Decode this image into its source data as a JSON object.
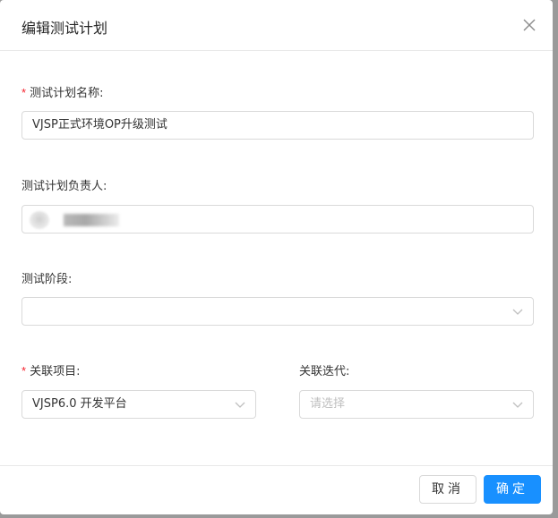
{
  "modal": {
    "title": "编辑测试计划",
    "close_icon": "close-icon"
  },
  "form": {
    "plan_name": {
      "required_mark": "*",
      "label": "测试计划名称:",
      "value": "VJSP正式环境OP升级测试"
    },
    "owner": {
      "label": "测试计划负责人:",
      "value_redacted": true
    },
    "stage": {
      "label": "测试阶段:",
      "value": ""
    },
    "project": {
      "required_mark": "*",
      "label": "关联项目:",
      "value": "VJSP6.0 开发平台"
    },
    "iteration": {
      "label": "关联迭代:",
      "placeholder": "请选择"
    }
  },
  "footer": {
    "cancel_label": "取消",
    "ok_label": "确定"
  },
  "colors": {
    "primary": "#1890ff",
    "required": "#f5222d",
    "border": "#d9d9d9"
  }
}
